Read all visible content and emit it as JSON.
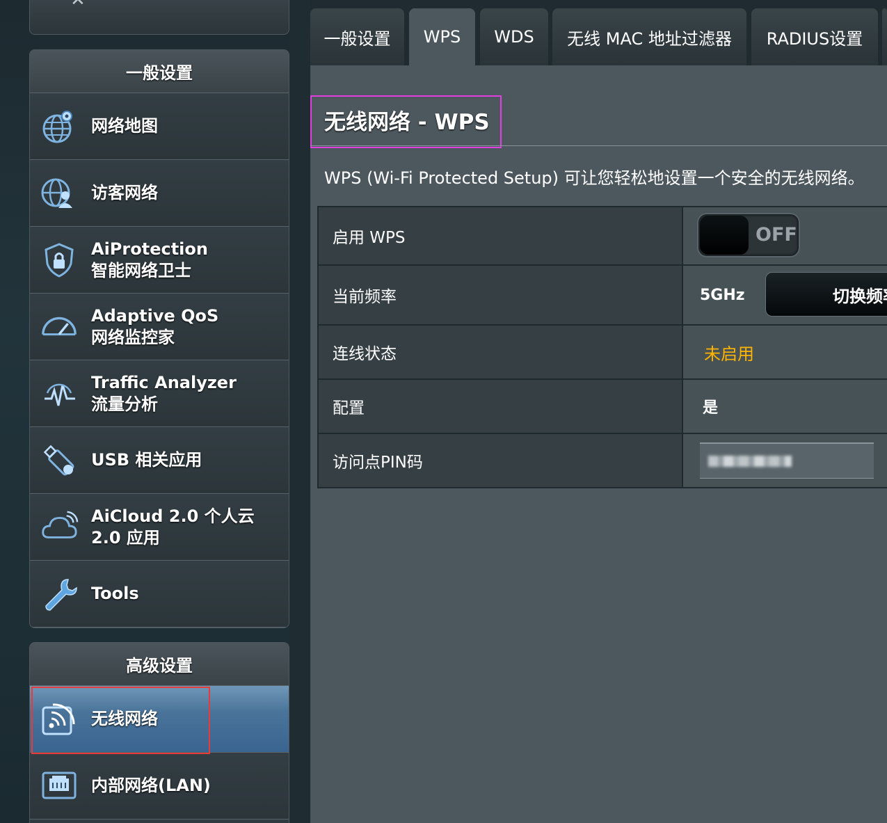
{
  "sidebar": {
    "general_header": "一般设置",
    "advanced_header": "高级设置",
    "general_items": [
      {
        "line1": "网络地图",
        "line2": "",
        "icon": "globe-pin-icon"
      },
      {
        "line1": "访客网络",
        "line2": "",
        "icon": "guest-network-icon"
      },
      {
        "line1": "AiProtection",
        "line2": "智能网络卫士",
        "icon": "shield-lock-icon"
      },
      {
        "line1": "Adaptive QoS",
        "line2": "网络监控家",
        "icon": "speedometer-icon"
      },
      {
        "line1": "Traffic Analyzer",
        "line2": "流量分析",
        "icon": "traffic-analyzer-icon"
      },
      {
        "line1": "USB 相关应用",
        "line2": "",
        "icon": "usb-icon"
      },
      {
        "line1": "AiCloud 2.0 个人云",
        "line2": "2.0 应用",
        "icon": "cloud-icon"
      },
      {
        "line1": "Tools",
        "line2": "",
        "icon": "wrench-icon"
      }
    ],
    "advanced_items": [
      {
        "line1": "无线网络",
        "line2": "",
        "icon": "wireless-icon",
        "selected": true
      },
      {
        "line1": "内部网络(LAN)",
        "line2": "",
        "icon": "lan-icon",
        "selected": false
      }
    ]
  },
  "tabs": [
    {
      "label": "一般设置",
      "active": false
    },
    {
      "label": "WPS",
      "active": true
    },
    {
      "label": "WDS",
      "active": false
    },
    {
      "label": "无线 MAC 地址过滤器",
      "active": false
    },
    {
      "label": "RADIUS设置",
      "active": false
    }
  ],
  "page": {
    "title": "无线网络 - WPS",
    "description": "WPS (Wi-Fi Protected Setup) 可让您轻松地设置一个安全的无线网络。"
  },
  "settings": {
    "enable_wps_label": "启用 WPS",
    "enable_wps_state": "OFF",
    "frequency_label": "当前频率",
    "frequency_value": "5GHz",
    "switch_frequency_button": "切换频率",
    "connection_status_label": "连线状态",
    "connection_status_value": "未启用",
    "configured_label": "配置",
    "configured_value": "是",
    "ap_pin_label": "访问点PIN码"
  },
  "colors": {
    "status_warning": "#ffb400",
    "selected_menu": "#4a7399",
    "highlight_magenta": "#e040e0",
    "highlight_red": "#e53b3b"
  }
}
